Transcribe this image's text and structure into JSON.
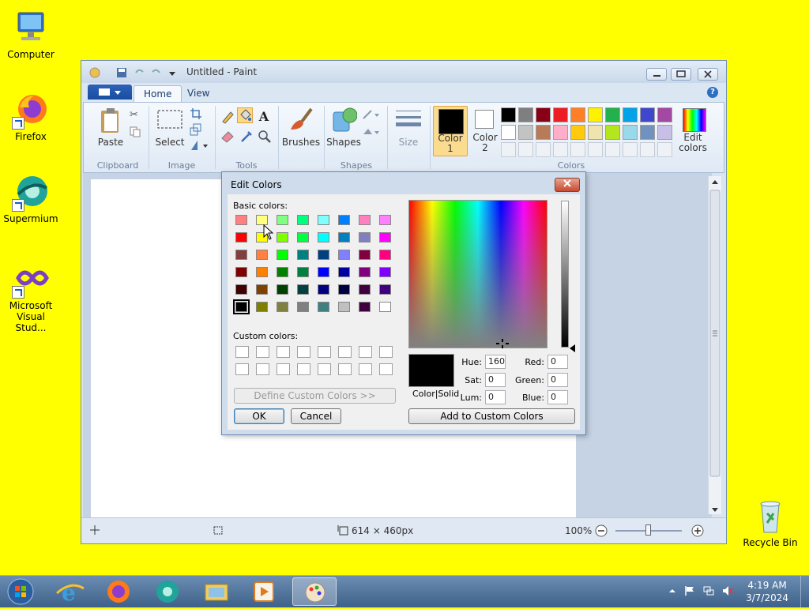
{
  "desktop": {
    "icons": [
      {
        "label": "Computer"
      },
      {
        "label": "Firefox"
      },
      {
        "label": "Supermium"
      },
      {
        "label": "Microsoft Visual Stud..."
      },
      {
        "label": "Recycle Bin"
      }
    ]
  },
  "paint": {
    "title": "Untitled - Paint",
    "tabs": [
      "Home",
      "View"
    ],
    "groups": {
      "clipboard": "Clipboard",
      "image": "Image",
      "tools": "Tools",
      "shapes": "Shapes",
      "colors": "Colors"
    },
    "buttons": {
      "paste": "Paste",
      "select": "Select",
      "brushes": "Brushes",
      "shapes": "Shapes",
      "size": "Size",
      "color1": "Color 1",
      "color2": "Color 2",
      "edit_colors": "Edit colors"
    },
    "palette_row1": [
      "#000000",
      "#7f7f7f",
      "#880015",
      "#ed1c24",
      "#ff7f27",
      "#fff200",
      "#22b14c",
      "#00a2e8",
      "#3f48cc",
      "#a349a4"
    ],
    "palette_row2": [
      "#ffffff",
      "#c3c3c3",
      "#b97a57",
      "#ffaec9",
      "#ffc90e",
      "#efe4b0",
      "#b5e61d",
      "#99d9ea",
      "#7092be",
      "#c8bfe7"
    ],
    "status": {
      "dimensions": "614 × 460px",
      "zoom": "100%"
    }
  },
  "dialog": {
    "title": "Edit Colors",
    "basic_label": "Basic colors:",
    "custom_label": "Custom colors:",
    "basic_colors": [
      [
        "#ff8080",
        "#ffff80",
        "#80ff80",
        "#00ff80",
        "#80ffff",
        "#0080ff",
        "#ff80c0",
        "#ff80ff"
      ],
      [
        "#ff0000",
        "#ffff00",
        "#80ff00",
        "#00ff40",
        "#00ffff",
        "#0080c0",
        "#8080c0",
        "#ff00ff"
      ],
      [
        "#804040",
        "#ff8040",
        "#00ff00",
        "#008080",
        "#004080",
        "#8080ff",
        "#800040",
        "#ff0080"
      ],
      [
        "#800000",
        "#ff8000",
        "#008000",
        "#008040",
        "#0000ff",
        "#0000a0",
        "#800080",
        "#8000ff"
      ],
      [
        "#400000",
        "#804000",
        "#004000",
        "#004040",
        "#000080",
        "#000040",
        "#400040",
        "#400080"
      ],
      [
        "#000000",
        "#808000",
        "#808040",
        "#808080",
        "#408080",
        "#c0c0c0",
        "#400040",
        "#ffffff"
      ]
    ],
    "define_custom": "Define Custom Colors >>",
    "ok": "OK",
    "cancel": "Cancel",
    "add_custom": "Add to Custom Colors",
    "color_solid": "Color|Solid",
    "fields": {
      "hue_label": "Hue:",
      "hue": "160",
      "sat_label": "Sat:",
      "sat": "0",
      "lum_label": "Lum:",
      "lum": "0",
      "red_label": "Red:",
      "red": "0",
      "green_label": "Green:",
      "green": "0",
      "blue_label": "Blue:",
      "blue": "0"
    }
  },
  "taskbar": {
    "time": "4:19 AM",
    "date": "3/7/2024"
  }
}
